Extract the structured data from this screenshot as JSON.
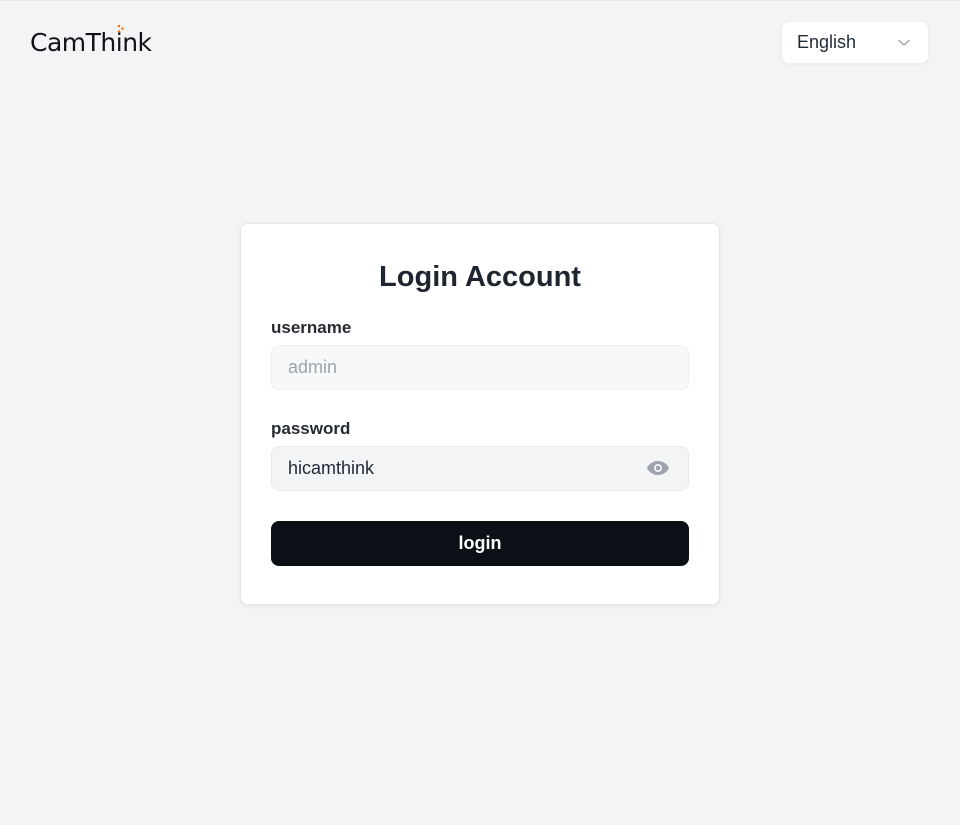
{
  "header": {
    "logo": {
      "text": "CamThink",
      "accent_color": "#f97316"
    },
    "language": {
      "selected": "English",
      "icon": "chevron-down-icon"
    }
  },
  "login_card": {
    "title": "Login Account",
    "username": {
      "label": "username",
      "value": "",
      "placeholder": "admin"
    },
    "password": {
      "label": "password",
      "value": "hicamthink",
      "toggle_icon": "eye-icon"
    },
    "submit_label": "login"
  },
  "colors": {
    "page_background": "#f3f4f6",
    "card_background": "#ffffff",
    "button_background": "#0b0f16",
    "button_text": "#ffffff"
  }
}
